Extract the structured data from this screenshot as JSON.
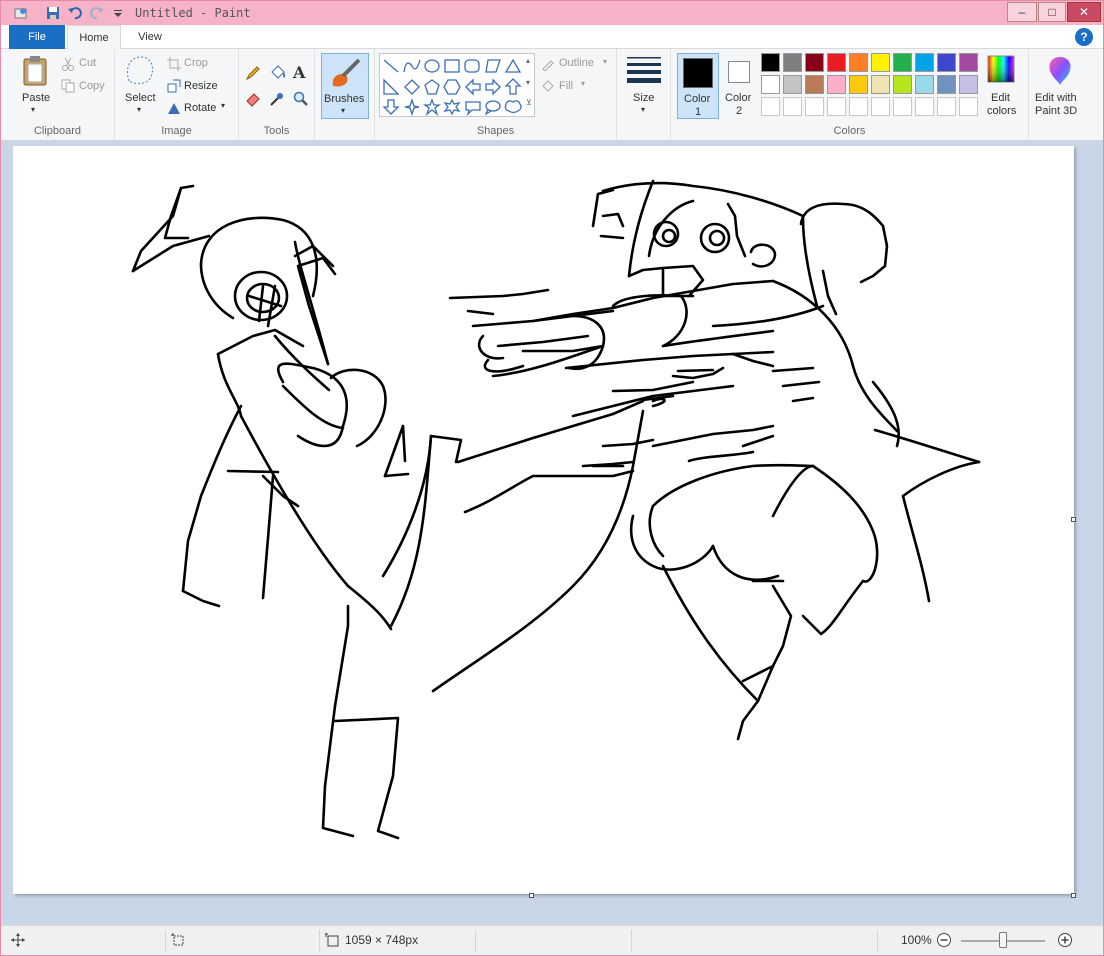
{
  "window": {
    "title": "Untitled - Paint",
    "minimize": "–",
    "maximize": "□",
    "close": "✕"
  },
  "tabs": [
    {
      "label": "File"
    },
    {
      "label": "Home"
    },
    {
      "label": "View"
    }
  ],
  "help": "?",
  "clipboard": {
    "paste": "Paste",
    "cut": "Cut",
    "copy": "Copy",
    "group": "Clipboard"
  },
  "image": {
    "select": "Select",
    "crop": "Crop",
    "resize": "Resize",
    "rotate": "Rotate",
    "group": "Image"
  },
  "tools": {
    "group": "Tools"
  },
  "brushes": {
    "label": "Brushes"
  },
  "shapes": {
    "outline": "Outline",
    "fill": "Fill",
    "group": "Shapes"
  },
  "size": {
    "label": "Size"
  },
  "colors": {
    "color1": "Color",
    "color1_num": "1",
    "color2": "Color",
    "color2_num": "2",
    "edit": "Edit",
    "edit2": "colors",
    "paint3d": "Edit with",
    "paint3d2": "Paint 3D",
    "group": "Colors",
    "palette_row1": [
      "#000000",
      "#7f7f7f",
      "#880015",
      "#ed1c24",
      "#ff7f27",
      "#fff200",
      "#22b14c",
      "#00a2e8",
      "#3f48cc",
      "#a349a4"
    ],
    "palette_row2": [
      "#ffffff",
      "#c3c3c3",
      "#b97a57",
      "#ffaec9",
      "#ffc90e",
      "#efe4b0",
      "#b5e61d",
      "#99d9ea",
      "#7092be",
      "#c8bfe7"
    ],
    "primary": "#000000",
    "secondary": "#ffffff"
  },
  "status": {
    "dimensions": "1059 × 748px",
    "zoom": "100%"
  }
}
